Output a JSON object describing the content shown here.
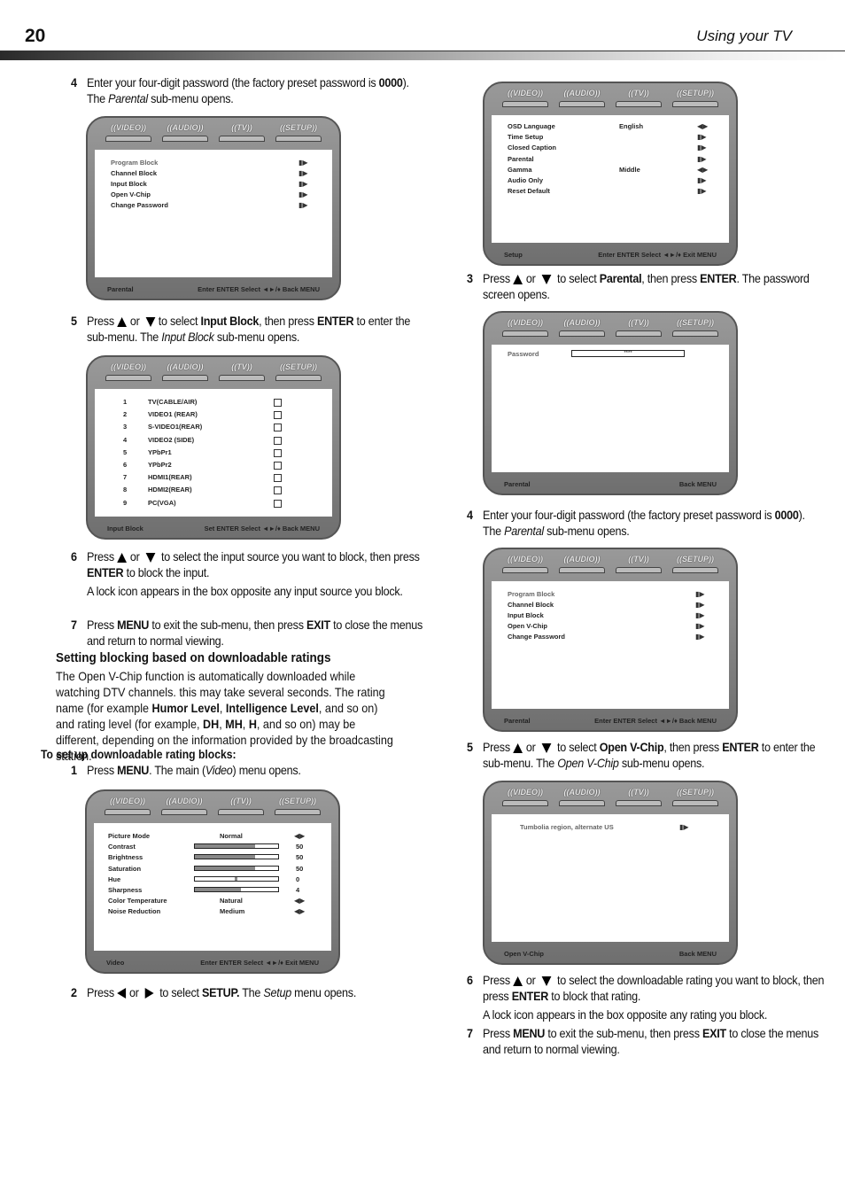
{
  "header": {
    "page_number": "20",
    "section": "Using your TV"
  },
  "left": {
    "step4": {
      "num": "4",
      "a": "Enter your four-digit password (the factory preset password is ",
      "b": "0000",
      "c": "). The ",
      "d": "Parental",
      "e": " sub-menu opens."
    },
    "step5": {
      "num": "5",
      "a": "Press",
      "or": "or",
      "b": "to select ",
      "c": "Input Block",
      "d": ", then press ",
      "e": "ENTER",
      "f": " to enter the sub-menu. The ",
      "g": "Input Block",
      "h": " sub-menu opens."
    },
    "step6": {
      "num": "6",
      "a": "Press",
      "or": "or",
      "b": " to select the input source you want to block, then press ",
      "c": "ENTER",
      "d": " to block the input.",
      "note": "A lock icon appears in the box opposite any input source you block."
    },
    "step7": {
      "num": "7",
      "a": "Press ",
      "b": "MENU",
      "c": " to exit the sub-menu, then press ",
      "d": "EXIT",
      "e": " to close the menus and return to normal viewing."
    },
    "heading": "Setting blocking based on downloadable ratings",
    "para": {
      "a": "The Open V-Chip function is automatically downloaded while watching DTV channels. this may take several seconds. The rating name (for example ",
      "b": "Humor Level",
      "c": ", ",
      "d": "Intelligence Level",
      "e": ", and so on) and rating level (for example, ",
      "f": "DH",
      "g": ", ",
      "h": "MH",
      "i": ", ",
      "j": "H",
      "k": ", and so on) may be different, depending on the information provided by the broadcasting station."
    },
    "subheading": "To set up downloadable rating blocks:",
    "s1": {
      "num": "1",
      "a": "Press ",
      "b": "MENU",
      "c": ". The main (",
      "d": "Video",
      "e": ") menu opens."
    },
    "s2": {
      "num": "2",
      "a": "Press",
      "or": "or",
      "b": " to select ",
      "c": "SETUP.",
      "d": " The ",
      "e": "Setup",
      "f": " menu opens."
    }
  },
  "right": {
    "s3": {
      "num": "3",
      "a": "Press",
      "or": "or",
      "b": " to select ",
      "c": "Parental",
      "d": ", then press ",
      "e": "ENTER",
      "f": ". The password screen opens."
    },
    "s4": {
      "num": "4",
      "a": "Enter your four-digit password (the factory preset password is ",
      "b": "0000",
      "c": "). The ",
      "d": "Parental",
      "e": " sub-menu opens."
    },
    "s5": {
      "num": "5",
      "a": "Press",
      "or": "or",
      "b": " to select ",
      "c": "Open V-Chip",
      "d": ", then press ",
      "e": "ENTER",
      "f": " to enter the sub-menu. The ",
      "g": "Open V-Chip",
      "h": " sub-menu opens."
    },
    "s6": {
      "num": "6",
      "a": "Press",
      "or": "or",
      "b": " to select the downloadable rating you want to block, then press ",
      "c": "ENTER",
      "d": " to block that rating.",
      "note": "A lock icon appears in the box opposite any rating you block."
    },
    "s7": {
      "num": "7",
      "a": "Press ",
      "b": "MENU",
      "c": " to exit the sub-menu, then press ",
      "d": "EXIT",
      "e": " to close the menus and return to normal viewing."
    }
  },
  "osd_tabs": [
    "VIDEO",
    "AUDIO",
    "TV",
    "SETUP"
  ],
  "osd": {
    "parental": {
      "items": [
        "Program Block",
        "Channel Block",
        "Input Block",
        "Open V-Chip",
        "Change Password"
      ],
      "footer_title": "Parental",
      "footer_hint": "Enter ENTER Select ◄►/♦ Back MENU"
    },
    "input_block": {
      "items": [
        {
          "n": "1",
          "label": "TV(CABLE/AIR)"
        },
        {
          "n": "2",
          "label": "VIDEO1 (REAR)"
        },
        {
          "n": "3",
          "label": "S-VIDEO1(REAR)"
        },
        {
          "n": "4",
          "label": "VIDEO2 (SIDE)"
        },
        {
          "n": "5",
          "label": "YPbPr1"
        },
        {
          "n": "6",
          "label": "YPbPr2"
        },
        {
          "n": "7",
          "label": "HDMI1(REAR)"
        },
        {
          "n": "8",
          "label": "HDMI2(REAR)"
        },
        {
          "n": "9",
          "label": "PC(VGA)"
        }
      ],
      "footer_title": "Input Block",
      "footer_hint": "Set ENTER Select ◄►/♦ Back MENU"
    },
    "video": {
      "items": [
        {
          "label": "Picture Mode",
          "value": "Normal"
        },
        {
          "label": "Contrast",
          "value": "50",
          "level": 0.72
        },
        {
          "label": "Brightness",
          "value": "50",
          "level": 0.72
        },
        {
          "label": "Saturation",
          "value": "50",
          "level": 0.72
        },
        {
          "label": "Hue",
          "value": "0",
          "level": 0.5
        },
        {
          "label": "Sharpness",
          "value": "4",
          "level": 0.55
        },
        {
          "label": "Color Temperature",
          "value": "Natural"
        },
        {
          "label": "Noise Reduction",
          "value": "Medium"
        }
      ],
      "footer_title": "Video",
      "footer_hint": "Enter ENTER Select ◄►/♦ Exit MENU"
    },
    "setup": {
      "items": [
        {
          "label": "OSD Language",
          "value": "English"
        },
        {
          "label": "Time Setup",
          "value": ""
        },
        {
          "label": "Closed Caption",
          "value": ""
        },
        {
          "label": "Parental",
          "value": ""
        },
        {
          "label": "Gamma",
          "value": "Middle"
        },
        {
          "label": "Audio Only",
          "value": ""
        },
        {
          "label": "Reset Default",
          "value": ""
        }
      ],
      "footer_title": "Setup",
      "footer_hint": "Enter ENTER Select ◄►/♦ Exit MENU"
    },
    "password": {
      "label": "Password",
      "value": "****",
      "footer_title": "Parental",
      "footer_hint": "Back MENU"
    },
    "vchip": {
      "item": "Tumbolia region, alternate US",
      "footer_title": "Open V-Chip",
      "footer_hint": "Back MENU"
    }
  }
}
